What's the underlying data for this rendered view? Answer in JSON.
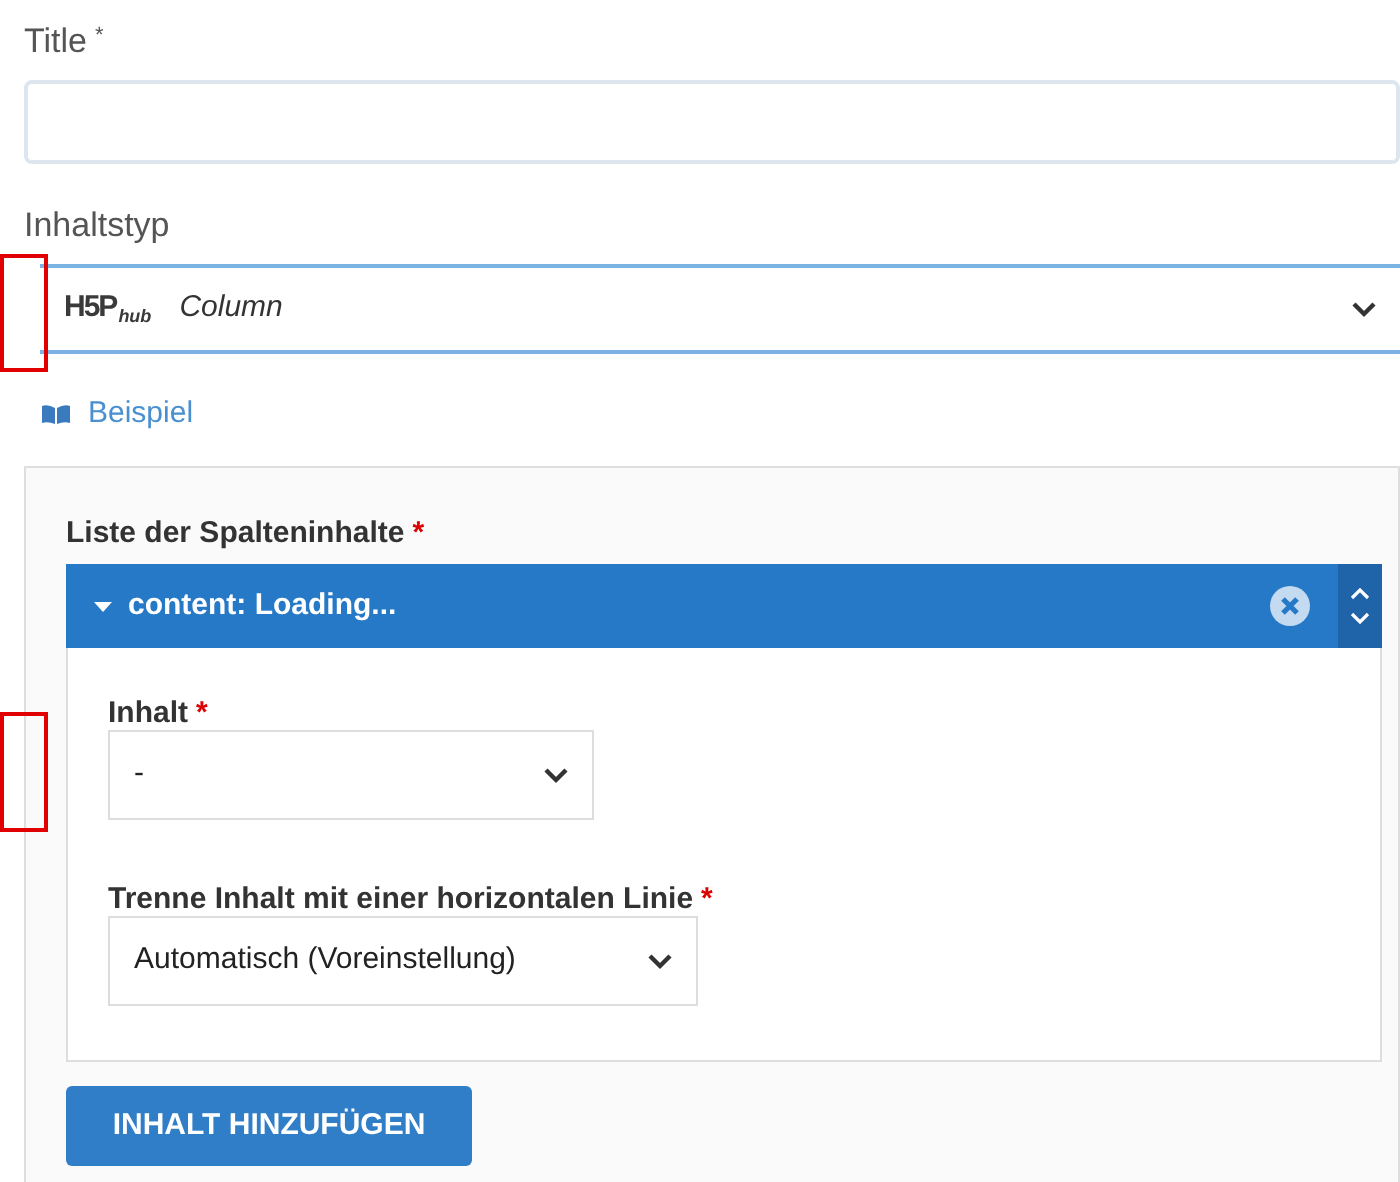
{
  "title_field": {
    "label": "Title",
    "required_mark": "*"
  },
  "content_type": {
    "label": "Inhaltstyp",
    "logo": "H5P",
    "logo_suffix": "hub",
    "value": "Column"
  },
  "example_link": "Beispiel",
  "list": {
    "label": "Liste der Spalteninhalte",
    "required_mark": "*",
    "item": {
      "title": "content: Loading...",
      "expanded": true,
      "fields": [
        {
          "label": "Inhalt",
          "required_mark": "*",
          "value": "-"
        },
        {
          "label": "Trenne Inhalt mit einer horizontalen Linie",
          "required_mark": "*",
          "value": "Automatisch (Voreinstellung)"
        }
      ]
    },
    "add_button": "INHALT HINZUFÜGEN"
  }
}
